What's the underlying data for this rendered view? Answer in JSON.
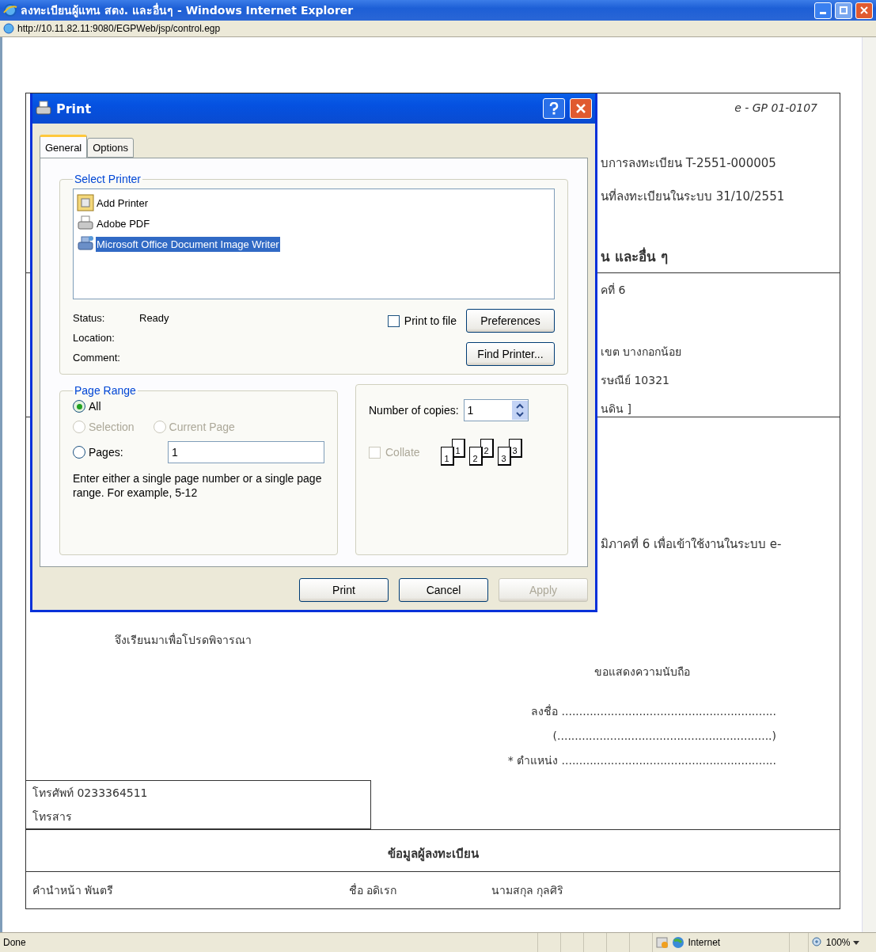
{
  "window": {
    "title": "ลงทะเบียนผู้แทน สตง. และอื่นๆ - Windows Internet Explorer"
  },
  "address_bar": {
    "url": "http://10.11.82.11:9080/EGPWeb/jsp/control.egp"
  },
  "document": {
    "form_code": "e - GP 01-0107",
    "header_lines": [
      "บการลงทะเบียน T-2551-000005",
      "นที่ลงทะเบียนในระบบ 31/10/2551"
    ],
    "heading": "น และอื่น ๆ",
    "address_lines": [
      "คที่ 6",
      "เขต บางกอกน้อย",
      "รษณีย์ 10321",
      "นดิน ]"
    ],
    "body_line": "มิภาคที่ 6 เพื่อเข้าใช้งานในระบบ e-",
    "closing": "จึงเรียนมาเพื่อโปรดพิจารณา",
    "regards": "ขอแสดงความนับถือ",
    "signature_lines": [
      "ลงชื่อ .............................................................",
      "(.............................................................)",
      "* ตำแหน่ง ............................................................."
    ],
    "contact": [
      "โทรศัพท์ 0233364511",
      "โทรสาร"
    ],
    "section_title": "ข้อมูลผู้ลงทะเบียน",
    "registrant": [
      "คำนำหน้า  พันตรี",
      "ชื่อ อดิเรก",
      "นามสกุล  กุลศิริ"
    ]
  },
  "print_dialog": {
    "title": "Print",
    "tabs": [
      {
        "label": "General",
        "selected": true
      },
      {
        "label": "Options",
        "selected": false
      }
    ],
    "select_printer": {
      "label": "Select Printer",
      "printers": [
        {
          "name": "Add Printer",
          "kind": "add",
          "selected": false
        },
        {
          "name": "Adobe PDF",
          "kind": "printer",
          "selected": false
        },
        {
          "name": "Microsoft Office Document Image Writer",
          "kind": "network",
          "selected": true
        }
      ],
      "status_label": "Status:",
      "status": "Ready",
      "location_label": "Location:",
      "comment_label": "Comment:",
      "print_to_file": {
        "label": "Print to file",
        "checked": false
      },
      "preferences": "Preferences",
      "find_printer": "Find Printer..."
    },
    "page_range": {
      "label": "Page Range",
      "options": [
        {
          "label": "All",
          "selected": true,
          "disabled": false
        },
        {
          "label": "Selection",
          "selected": false,
          "disabled": true
        },
        {
          "label": "Current Page",
          "selected": false,
          "disabled": true
        },
        {
          "label": "Pages:",
          "selected": false,
          "disabled": false
        }
      ],
      "pages_value": "1",
      "hint": "Enter either a single page number or a single page range.  For example, 5-12"
    },
    "copies": {
      "label": "Number of copies:",
      "value": "1",
      "collate": {
        "label": "Collate",
        "checked": false,
        "disabled": true
      },
      "collate_sets": [
        {
          "back": "1",
          "front": "1"
        },
        {
          "back": "2",
          "front": "2"
        },
        {
          "back": "3",
          "front": "3"
        }
      ]
    },
    "buttons": [
      {
        "label": "Print",
        "disabled": false
      },
      {
        "label": "Cancel",
        "disabled": false
      },
      {
        "label": "Apply",
        "disabled": true
      }
    ]
  },
  "status_bar": {
    "text": "Done",
    "zone": "Internet",
    "zoom": "100%"
  }
}
